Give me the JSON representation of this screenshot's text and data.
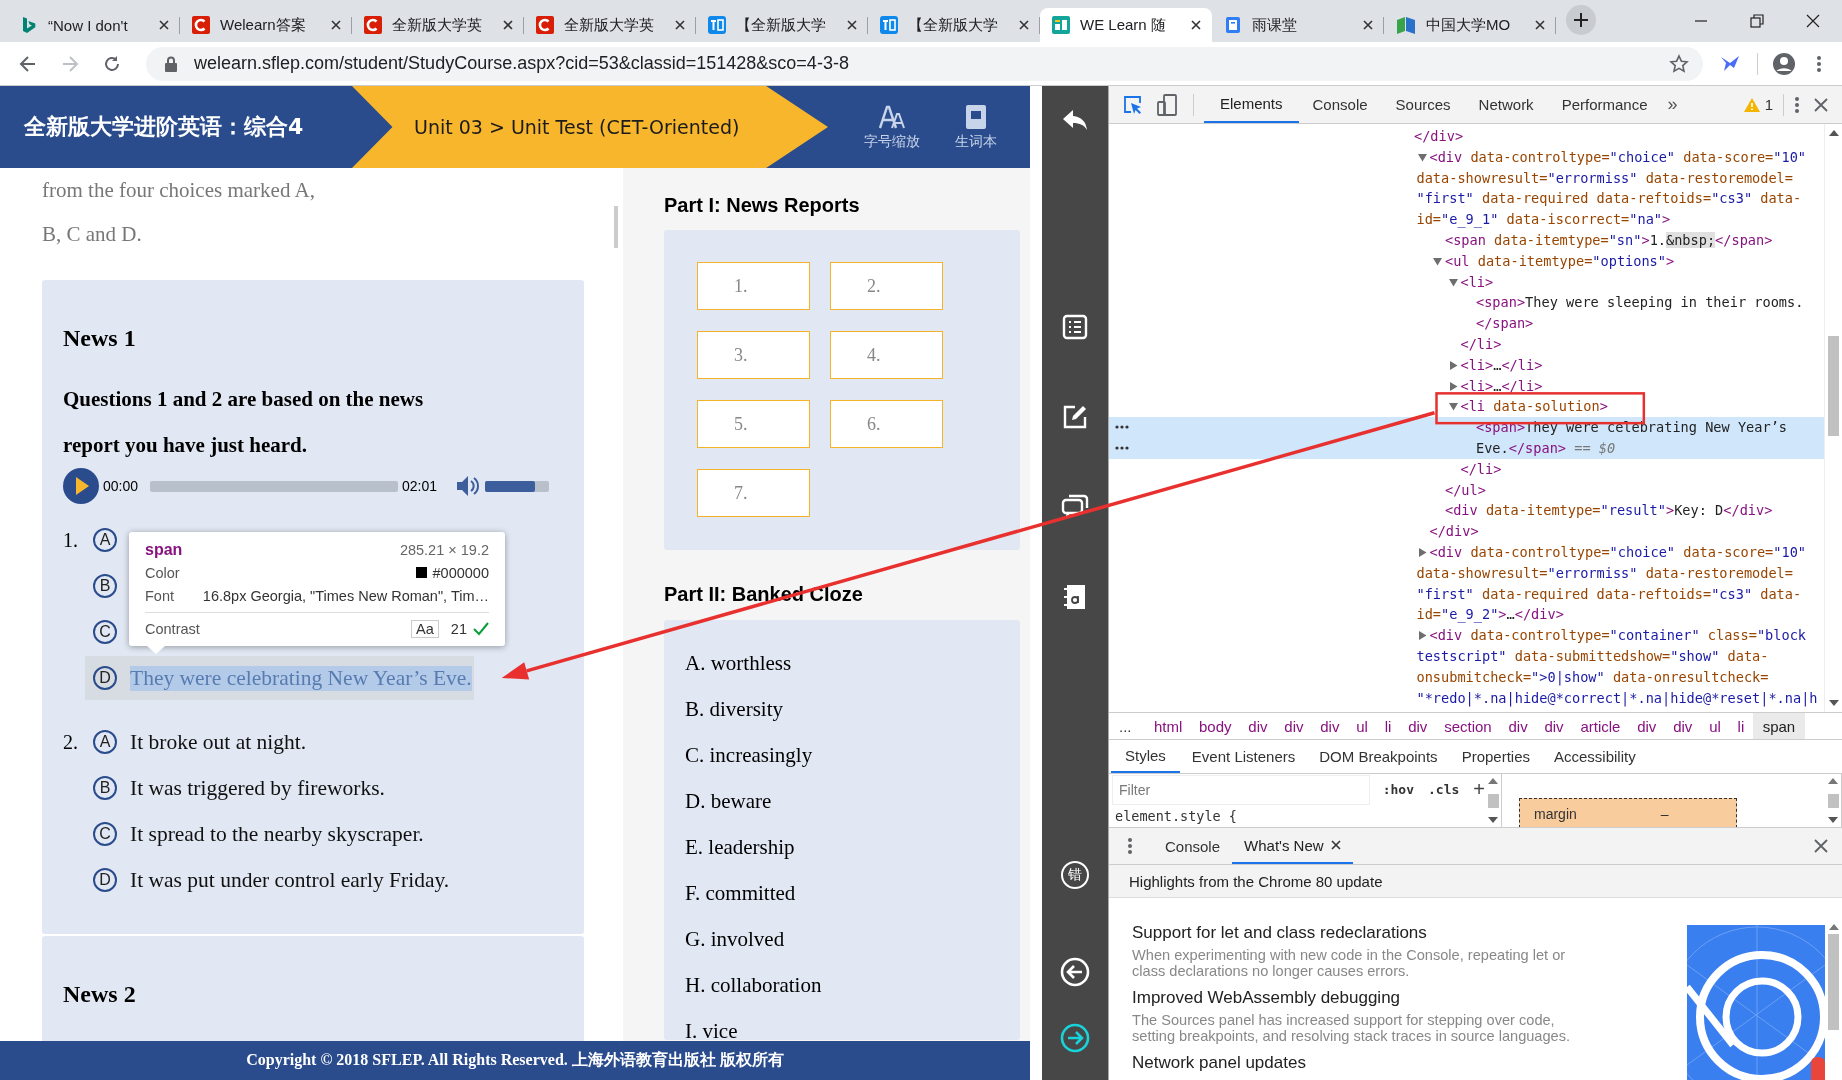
{
  "browser": {
    "tabs": [
      {
        "title": "“Now I don't",
        "kind": "bing",
        "selected": false
      },
      {
        "title": "Welearn答案",
        "kind": "csdn",
        "selected": false
      },
      {
        "title": "全新版大学英",
        "kind": "csdn",
        "selected": false
      },
      {
        "title": "全新版大学英",
        "kind": "csdn",
        "selected": false
      },
      {
        "title": "【全新版大学",
        "kind": "zhihu",
        "selected": false
      },
      {
        "title": "【全新版大学",
        "kind": "zhihu",
        "selected": false
      },
      {
        "title": "WE Learn 随",
        "kind": "course",
        "selected": true
      },
      {
        "title": "雨课堂",
        "kind": "rain",
        "selected": false
      },
      {
        "title": "中国大学MO",
        "kind": "mooc",
        "selected": false
      }
    ],
    "address": "welearn.sflep.com/student/StudyCourse.aspx?cid=53&classid=151428&sco=4-3-8"
  },
  "page": {
    "header": {
      "course_title": "全新版大学进阶英语：综合4",
      "breadcrumb": "Unit 03 > Unit Test (CET-Oriented)",
      "tools": [
        {
          "label": "字号缩放",
          "kind": "font-size"
        },
        {
          "label": "生词本",
          "kind": "notebook"
        }
      ]
    },
    "intro_lines": [
      "from the four choices marked A,",
      "B, C and D."
    ],
    "news_cards": [
      {
        "heading": "News 1",
        "instruction_lines": [
          "Questions 1 and 2 are based on the news",
          "report you have just heard."
        ],
        "audio": {
          "elapsed": "00:00",
          "duration": "02:01",
          "progress": {
            "level": 0
          },
          "volume": {
            "level": 0.78
          }
        },
        "questions": [
          {
            "number": "1.",
            "options": [
              {
                "letter": "A",
                "inspected": false
              },
              {
                "letter": "B",
                "inspected": false
              },
              {
                "letter": "C",
                "inspected": false
              },
              {
                "letter": "D",
                "text": "They were celebrating New Year’s Eve.",
                "inspected": true
              }
            ]
          },
          {
            "number": "2.",
            "options": [
              {
                "letter": "A",
                "text": "It broke out at night.",
                "inspected": false
              },
              {
                "letter": "B",
                "text": "It was triggered by fireworks.",
                "inspected": false
              },
              {
                "letter": "C",
                "text": "It spread to the nearby skyscraper.",
                "inspected": false
              },
              {
                "letter": "D",
                "text": "It was put under control early Friday.",
                "inspected": false
              }
            ]
          }
        ]
      },
      {
        "heading": "News 2"
      }
    ],
    "inspector_tooltip": {
      "tag": "span",
      "size": "285.21 × 19.2",
      "rows": [
        {
          "label": "Color",
          "value": "#000000",
          "kind": "color"
        },
        {
          "label": "Font",
          "value": "16.8px Georgia, \"Times New Roman\", Tim…",
          "kind": "text"
        }
      ],
      "contrast": {
        "label": "Contrast",
        "sample": "Aa",
        "ratio": "21",
        "passes": true
      }
    },
    "sections": [
      {
        "heading": "Part I: News Reports",
        "kind": "answer-grid",
        "items": [
          "1.",
          "2.",
          "3.",
          "4.",
          "5.",
          "6.",
          "7."
        ]
      },
      {
        "heading": "Part II: Banked Cloze",
        "kind": "word-bank",
        "items": [
          "A. worthless",
          "B. diversity",
          "C. increasingly",
          "D. beware",
          "E. leadership",
          "F. committed",
          "G. involved",
          "H. collaboration",
          "I. vice"
        ]
      }
    ],
    "footer": "Copyright © 2018 SFLEP. All Rights Reserved. 上海外语教育出版社 版权所有"
  },
  "side_toolbar": {
    "top": [
      {
        "kind": "back"
      },
      {
        "kind": "list"
      },
      {
        "kind": "edit"
      },
      {
        "kind": "chat"
      },
      {
        "kind": "dictionary"
      }
    ],
    "bottom": [
      {
        "kind": "mistakes",
        "label": "错"
      },
      {
        "kind": "prev"
      },
      {
        "kind": "next"
      }
    ]
  },
  "devtools": {
    "tabs": [
      {
        "label": "Elements",
        "selected": true
      },
      {
        "label": "Console",
        "selected": false
      },
      {
        "label": "Sources",
        "selected": false
      },
      {
        "label": "Network",
        "selected": false
      },
      {
        "label": "Performance",
        "selected": false
      }
    ],
    "more": "»",
    "warnings": "1",
    "dom_tree": {
      "leading_close": [
        {
          "kind": "tag",
          "text": "</div>"
        }
      ],
      "nodes": [
        {
          "selected": false,
          "expanded": true,
          "lines": [
            [
              {
                "kind": "tag",
                "text": "<div"
              },
              {
                "kind": "attr",
                "text": " data-controltype="
              },
              {
                "kind": "val",
                "text": "\"choice\""
              },
              {
                "kind": "attr",
                "text": " data-score="
              },
              {
                "kind": "val",
                "text": "\"10\""
              }
            ],
            [
              {
                "kind": "attr",
                "text": "data-showresult="
              },
              {
                "kind": "val",
                "text": "\"errormiss\""
              },
              {
                "kind": "attr",
                "text": " data-restoremodel="
              }
            ],
            [
              {
                "kind": "val",
                "text": "\"first\""
              },
              {
                "kind": "attr",
                "text": " data-required data-reftoids="
              },
              {
                "kind": "val",
                "text": "\"cs3\""
              },
              {
                "kind": "attr",
                "text": " data-"
              }
            ],
            [
              {
                "kind": "attr",
                "text": "id="
              },
              {
                "kind": "val",
                "text": "\"e_9_1\""
              },
              {
                "kind": "attr",
                "text": " data-iscorrect="
              },
              {
                "kind": "val",
                "text": "\"na\""
              },
              {
                "kind": "tag",
                "text": ">"
              }
            ]
          ],
          "children": [
            {
              "selected": false,
              "lines": [
                [
                  {
                    "kind": "tag",
                    "text": "<span"
                  },
                  {
                    "kind": "attr",
                    "text": " data-itemtype="
                  },
                  {
                    "kind": "val",
                    "text": "\"sn\""
                  },
                  {
                    "kind": "tag",
                    "text": ">"
                  },
                  {
                    "kind": "text",
                    "text": "1."
                  },
                  {
                    "kind": "entity",
                    "text": "&nbsp;"
                  },
                  {
                    "kind": "tag",
                    "text": "</span>"
                  }
                ]
              ]
            },
            {
              "selected": false,
              "expanded": true,
              "lines": [
                [
                  {
                    "kind": "tag",
                    "text": "<ul"
                  },
                  {
                    "kind": "attr",
                    "text": " data-itemtype="
                  },
                  {
                    "kind": "val",
                    "text": "\"options\""
                  },
                  {
                    "kind": "tag",
                    "text": ">"
                  }
                ]
              ],
              "children": [
                {
                  "selected": false,
                  "expanded": true,
                  "lines": [
                    [
                      {
                        "kind": "tag",
                        "text": "<li>"
                      }
                    ]
                  ],
                  "children": [
                    {
                      "selected": false,
                      "lines": [
                        [
                          {
                            "kind": "tag",
                            "text": "<span>"
                          },
                          {
                            "kind": "text",
                            "text": "They were sleeping in their rooms."
                          }
                        ],
                        [
                          {
                            "kind": "tag",
                            "text": "</span>"
                          }
                        ]
                      ]
                    }
                  ],
                  "close": [
                    {
                      "kind": "tag",
                      "text": "</li>"
                    }
                  ]
                },
                {
                  "selected": false,
                  "expanded": false,
                  "lines": [
                    [
                      {
                        "kind": "tag",
                        "text": "<li>"
                      },
                      {
                        "kind": "text",
                        "text": "…"
                      },
                      {
                        "kind": "tag",
                        "text": "</li>"
                      }
                    ]
                  ]
                },
                {
                  "selected": false,
                  "expanded": false,
                  "lines": [
                    [
                      {
                        "kind": "tag",
                        "text": "<li>"
                      },
                      {
                        "kind": "text",
                        "text": "…"
                      },
                      {
                        "kind": "tag",
                        "text": "</li>"
                      }
                    ]
                  ]
                },
                {
                  "selected": false,
                  "expanded": true,
                  "framed": true,
                  "lines": [
                    [
                      {
                        "kind": "tag",
                        "text": "<li"
                      },
                      {
                        "kind": "attr",
                        "text": " data-solution"
                      },
                      {
                        "kind": "tag",
                        "text": ">"
                      }
                    ]
                  ],
                  "children": [
                    {
                      "selected": true,
                      "lines": [
                        [
                          {
                            "kind": "tag",
                            "text": "<span>"
                          },
                          {
                            "kind": "text",
                            "text": "They were celebrating New Year’s"
                          }
                        ],
                        [
                          {
                            "kind": "text",
                            "text": "Eve."
                          },
                          {
                            "kind": "tag",
                            "text": "</span>"
                          },
                          {
                            "kind": "dim",
                            "text": " == $0"
                          }
                        ]
                      ]
                    }
                  ],
                  "close": [
                    {
                      "kind": "tag",
                      "text": "</li>"
                    }
                  ]
                }
              ],
              "close": [
                {
                  "kind": "tag",
                  "text": "</ul>"
                }
              ]
            },
            {
              "selected": false,
              "lines": [
                [
                  {
                    "kind": "tag",
                    "text": "<div"
                  },
                  {
                    "kind": "attr",
                    "text": " data-itemtype="
                  },
                  {
                    "kind": "val",
                    "text": "\"result\""
                  },
                  {
                    "kind": "tag",
                    "text": ">"
                  },
                  {
                    "kind": "text",
                    "text": "Key: D"
                  },
                  {
                    "kind": "tag",
                    "text": "</div>"
                  }
                ]
              ]
            }
          ],
          "close": [
            {
              "kind": "tag",
              "text": "</div>"
            }
          ]
        },
        {
          "selected": false,
          "expanded": false,
          "lines": [
            [
              {
                "kind": "tag",
                "text": "<div"
              },
              {
                "kind": "attr",
                "text": " data-controltype="
              },
              {
                "kind": "val",
                "text": "\"choice\""
              },
              {
                "kind": "attr",
                "text": " data-score="
              },
              {
                "kind": "val",
                "text": "\"10\""
              }
            ],
            [
              {
                "kind": "attr",
                "text": "data-showresult="
              },
              {
                "kind": "val",
                "text": "\"errormiss\""
              },
              {
                "kind": "attr",
                "text": " data-restoremodel="
              }
            ],
            [
              {
                "kind": "val",
                "text": "\"first\""
              },
              {
                "kind": "attr",
                "text": " data-required data-reftoids="
              },
              {
                "kind": "val",
                "text": "\"cs3\""
              },
              {
                "kind": "attr",
                "text": " data-"
              }
            ],
            [
              {
                "kind": "attr",
                "text": "id="
              },
              {
                "kind": "val",
                "text": "\"e_9_2\""
              },
              {
                "kind": "tag",
                "text": ">"
              },
              {
                "kind": "text",
                "text": "…"
              },
              {
                "kind": "tag",
                "text": "</div>"
              }
            ]
          ]
        },
        {
          "selected": false,
          "expanded": false,
          "lines": [
            [
              {
                "kind": "tag",
                "text": "<div"
              },
              {
                "kind": "attr",
                "text": " data-controltype="
              },
              {
                "kind": "val",
                "text": "\"container\""
              },
              {
                "kind": "attr",
                "text": " class="
              },
              {
                "kind": "val",
                "text": "\"block"
              }
            ],
            [
              {
                "kind": "val",
                "text": "testscript\""
              },
              {
                "kind": "attr",
                "text": " data-submittedshow="
              },
              {
                "kind": "val",
                "text": "\"show\""
              },
              {
                "kind": "attr",
                "text": " data-"
              }
            ],
            [
              {
                "kind": "attr",
                "text": "onsubmitcheck="
              },
              {
                "kind": "val",
                "text": "\">0|show\""
              },
              {
                "kind": "attr",
                "text": " data-onresultcheck="
              }
            ],
            [
              {
                "kind": "val",
                "text": "\"*redo|*.na|hide@*correct|*.na|hide@*reset|*.na|h"
              }
            ]
          ]
        }
      ]
    },
    "breadcrumb": {
      "overflow": "...",
      "items": [
        {
          "label": "html",
          "selected": false
        },
        {
          "label": "body",
          "selected": false
        },
        {
          "label": "div",
          "selected": false
        },
        {
          "label": "div",
          "selected": false
        },
        {
          "label": "div",
          "selected": false
        },
        {
          "label": "ul",
          "selected": false
        },
        {
          "label": "li",
          "selected": false
        },
        {
          "label": "div",
          "selected": false
        },
        {
          "label": "section",
          "selected": false
        },
        {
          "label": "div",
          "selected": false
        },
        {
          "label": "div",
          "selected": false
        },
        {
          "label": "article",
          "selected": false
        },
        {
          "label": "div",
          "selected": false
        },
        {
          "label": "div",
          "selected": false
        },
        {
          "label": "ul",
          "selected": false
        },
        {
          "label": "li",
          "selected": false
        },
        {
          "label": "span",
          "selected": true
        }
      ]
    },
    "sidebar_tabs": [
      {
        "label": "Styles",
        "selected": true
      },
      {
        "label": "Event Listeners",
        "selected": false
      },
      {
        "label": "DOM Breakpoints",
        "selected": false
      },
      {
        "label": "Properties",
        "selected": false
      },
      {
        "label": "Accessibility",
        "selected": false
      }
    ],
    "styles": {
      "filter_placeholder": "Filter",
      "hov": ":hov",
      "cls": ".cls",
      "add": "+",
      "rule": "element.style {",
      "box_model": {
        "label": "margin",
        "value": "–"
      }
    },
    "drawer": {
      "tabs": [
        {
          "label": "Console",
          "selected": false,
          "closable": false
        },
        {
          "label": "What's New",
          "selected": true,
          "closable": true
        }
      ],
      "title": "Highlights from the Chrome 80 update",
      "articles": [
        {
          "title": "Support for let and class redeclarations",
          "lines": [
            "When experimenting with new code in the Console, repeating let or",
            "class declarations no longer causes errors."
          ]
        },
        {
          "title": "Improved WebAssembly debugging",
          "lines": [
            "The Sources panel has increased support for stepping over code,",
            "setting breakpoints, and resolving stack traces in source languages."
          ]
        },
        {
          "title": "Network panel updates"
        }
      ]
    }
  },
  "arrow_annotation": true
}
